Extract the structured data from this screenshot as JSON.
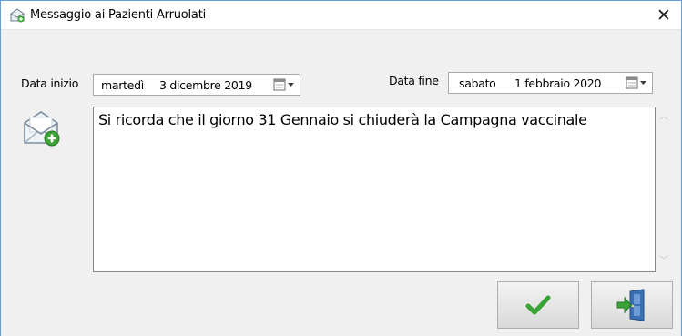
{
  "window": {
    "title": "Messaggio ai Pazienti Arruolati",
    "title_icon": "mail-add-icon",
    "close_label": "✕"
  },
  "dates": {
    "start_label": "Data inizio",
    "start_day": "martedì",
    "start_date": "3 dicembre 2019",
    "end_label": "Data fine",
    "end_day": "sabato",
    "end_date": "1 febbraio 2020"
  },
  "message": {
    "icon": "envelope-add-icon",
    "text": "Si ricorda che il giorno 31 Gennaio si chiuderà la Campagna vaccinale"
  },
  "buttons": {
    "confirm_icon": "checkmark-icon",
    "exit_icon": "exit-door-icon"
  },
  "colors": {
    "window_border": "#6a9bd1",
    "check_green": "#3aa335",
    "door_blue": "#3b6fb3"
  }
}
